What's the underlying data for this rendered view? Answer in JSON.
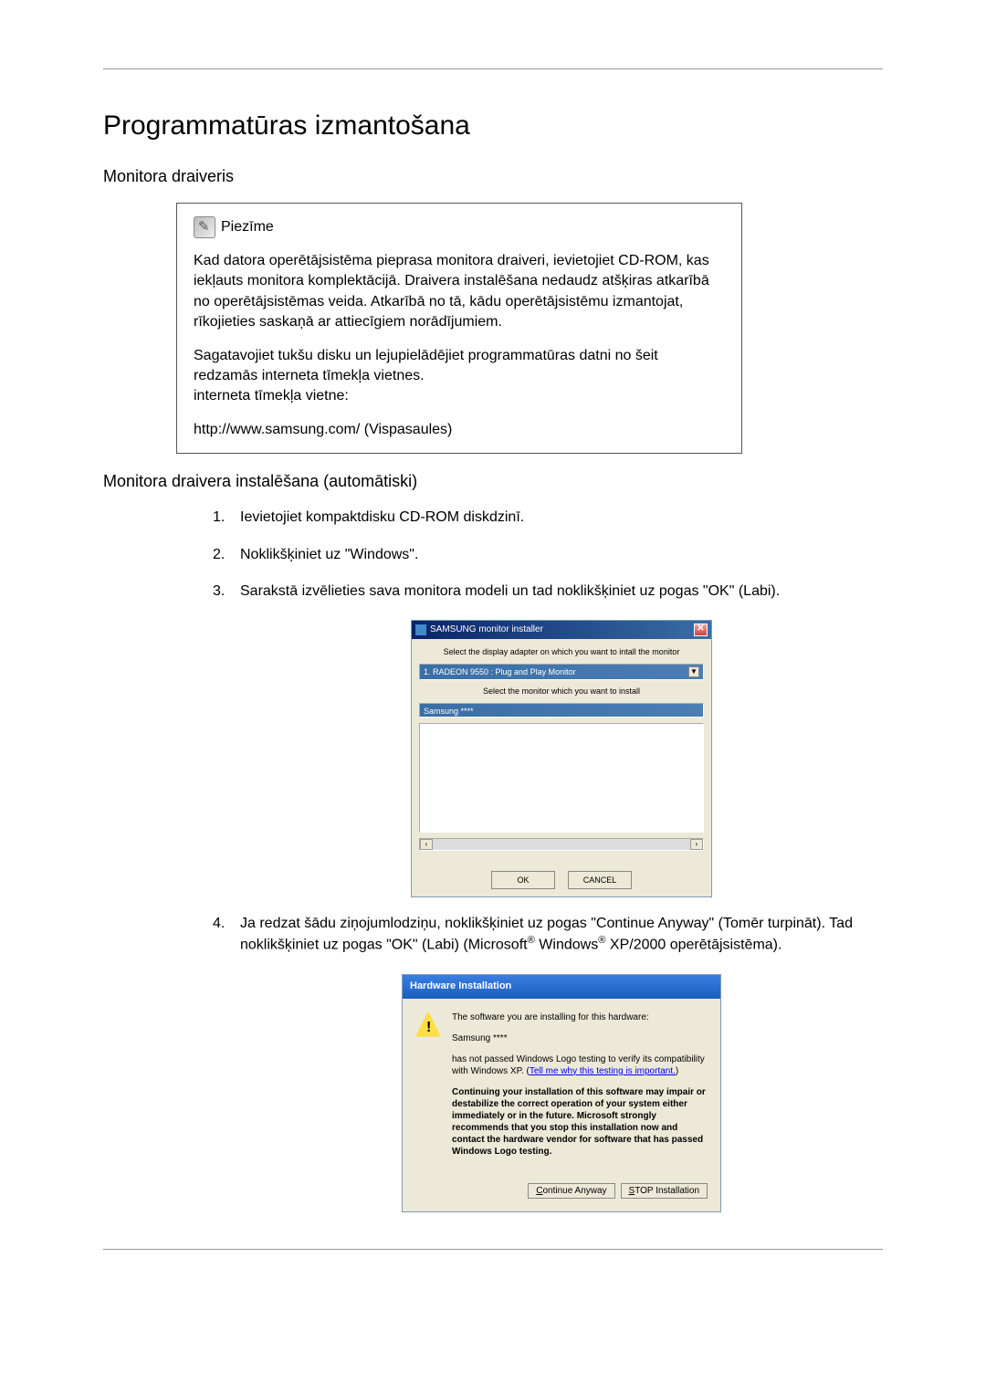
{
  "page_title": "Programmatūras izmantošana",
  "section1_title": "Monitora draiveris",
  "note": {
    "label": "Piezīme",
    "p1": "Kad datora operētājsistēma pieprasa monitora draiveri, ievietojiet CD-ROM, kas iekļauts monitora komplektācijā. Draivera instalēšana nedaudz atšķiras atkarībā no operētājsistēmas veida. Atkarībā no tā, kādu operētājsistēmu izmantojat, rīkojieties saskaņā ar attiecīgiem norādījumiem.",
    "p2": "Sagatavojiet tukšu disku un lejupielādējiet programmatūras datni no šeit redzamās interneta tīmekļa vietnes.",
    "p2_label": "interneta tīmekļa vietne:",
    "p3": "http://www.samsung.com/ (Vispasaules)"
  },
  "section2_title": "Monitora draivera instalēšana (automātiski)",
  "steps": {
    "s1": "Ievietojiet kompaktdisku CD-ROM diskdzinī.",
    "s2": "Noklikšķiniet uz \"Windows\".",
    "s3": "Sarakstā izvēlieties sava monitora modeli un tad noklikšķiniet uz pogas \"OK\" (Labi).",
    "s4a": "Ja redzat šādu ziņojumlodziņu, noklikšķiniet uz pogas \"Continue Anyway\" (Tomēr turpināt). Tad noklikšķiniet uz pogas \"OK\" (Labi) (Microsoft",
    "s4b": " Windows",
    "s4c": " XP/2000 operētājsistēma)."
  },
  "reg": "®",
  "installer": {
    "title": "SAMSUNG monitor installer",
    "label1": "Select the display adapter on which you want to intall the monitor",
    "dropdown": "1. RADEON 9550 : Plug and Play Monitor",
    "label2": "Select the monitor which you want to install",
    "list_item": "Samsung ****",
    "ok_btn": "OK",
    "cancel_btn": "CANCEL"
  },
  "hw": {
    "title": "Hardware Installation",
    "p1": "The software you are installing for this hardware:",
    "p2": "Samsung ****",
    "p3a": "has not passed Windows Logo testing to verify its compatibility with Windows XP. (",
    "p3_link": "Tell me why this testing is important.",
    "p3b": ")",
    "p4": "Continuing your installation of this software may impair or destabilize the correct operation of your system either immediately or in the future. Microsoft strongly recommends that you stop this installation now and contact the hardware vendor for software that has passed Windows Logo testing.",
    "cont_c": "C",
    "cont_rest": "ontinue Anyway",
    "stop_s": "S",
    "stop_rest": "TOP Installation"
  }
}
